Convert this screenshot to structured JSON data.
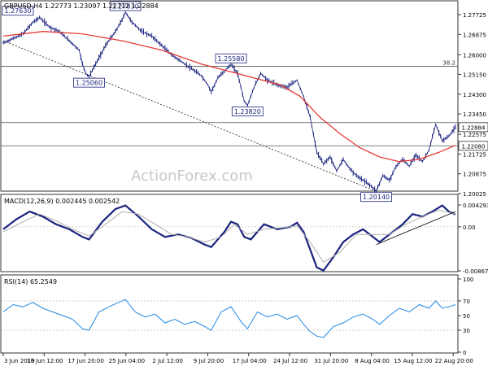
{
  "chart_data": [
    {
      "type": "candlestick",
      "header": "GBPUSD,H4  1.22773 1.23097 1.22712 1.22884",
      "watermark": "ActionForex.com",
      "ylim": [
        1.20025,
        1.27725
      ],
      "y_ticks": [
        "1.27725",
        "1.26875",
        "1.26000",
        "1.25150",
        "1.24300",
        "1.23450",
        "1.22575",
        "1.21725",
        "1.20875",
        "1.20025"
      ],
      "x_ticks": [
        "3 Jun 2019",
        "10 Jun 12:00",
        "17 Jun 20:00",
        "25 Jun 04:00",
        "2 Jul 12:00",
        "9 Jul 20:00",
        "17 Jul 04:00",
        "24 Jul 12:00",
        "31 Jul 20:00",
        "8 Aug 04:00",
        "15 Aug 12:00",
        "22 Aug 20:00"
      ],
      "price_path": [
        [
          0,
          1.265
        ],
        [
          3,
          1.267
        ],
        [
          6,
          1.269
        ],
        [
          9,
          1.274
        ],
        [
          11,
          1.276
        ],
        [
          14,
          1.272
        ],
        [
          17,
          1.27
        ],
        [
          20,
          1.266
        ],
        [
          23,
          1.262
        ],
        [
          24,
          1.256
        ],
        [
          25,
          1.252
        ],
        [
          26,
          1.2506
        ],
        [
          28,
          1.256
        ],
        [
          31,
          1.264
        ],
        [
          34,
          1.27
        ],
        [
          36,
          1.275
        ],
        [
          37,
          1.2783
        ],
        [
          39,
          1.274
        ],
        [
          42,
          1.27
        ],
        [
          45,
          1.268
        ],
        [
          48,
          1.264
        ],
        [
          51,
          1.26
        ],
        [
          54,
          1.257
        ],
        [
          57,
          1.254
        ],
        [
          60,
          1.251
        ],
        [
          62,
          1.247
        ],
        [
          63,
          1.244
        ],
        [
          65,
          1.25
        ],
        [
          67,
          1.253
        ],
        [
          69,
          1.2558
        ],
        [
          71,
          1.252
        ],
        [
          72,
          1.246
        ],
        [
          73,
          1.24
        ],
        [
          74,
          1.2382
        ],
        [
          76,
          1.246
        ],
        [
          78,
          1.252
        ],
        [
          80,
          1.249
        ],
        [
          83,
          1.247
        ],
        [
          86,
          1.246
        ],
        [
          89,
          1.249
        ],
        [
          91,
          1.242
        ],
        [
          93,
          1.233
        ],
        [
          95,
          1.218
        ],
        [
          97,
          1.213
        ],
        [
          99,
          1.216
        ],
        [
          101,
          1.21
        ],
        [
          103,
          1.215
        ],
        [
          105,
          1.211
        ],
        [
          107,
          1.208
        ],
        [
          109,
          1.206
        ],
        [
          111,
          1.204
        ],
        [
          113,
          1.2014
        ],
        [
          115,
          1.208
        ],
        [
          117,
          1.206
        ],
        [
          119,
          1.212
        ],
        [
          121,
          1.215
        ],
        [
          123,
          1.212
        ],
        [
          125,
          1.217
        ],
        [
          127,
          1.214
        ],
        [
          129,
          1.219
        ],
        [
          131,
          1.23
        ],
        [
          133,
          1.223
        ],
        [
          135,
          1.225
        ],
        [
          137,
          1.2288
        ]
      ],
      "moving_average": [
        [
          0,
          1.268
        ],
        [
          12,
          1.27
        ],
        [
          24,
          1.269
        ],
        [
          36,
          1.266
        ],
        [
          48,
          1.262
        ],
        [
          60,
          1.256
        ],
        [
          68,
          1.253
        ],
        [
          76,
          1.25
        ],
        [
          84,
          1.247
        ],
        [
          90,
          1.242
        ],
        [
          96,
          1.233
        ],
        [
          102,
          1.226
        ],
        [
          108,
          1.22
        ],
        [
          114,
          1.216
        ],
        [
          120,
          1.214
        ],
        [
          126,
          1.215
        ],
        [
          132,
          1.218
        ],
        [
          137,
          1.221
        ]
      ],
      "horizontal_levels": [
        {
          "value": 1.255,
          "label": "38.2"
        },
        {
          "value": 1.2308
        },
        {
          "value": 1.2208
        }
      ],
      "price_labels": [
        {
          "text": "1.27630",
          "x": 3,
          "y": 1.2763,
          "pos": "above"
        },
        {
          "text": "1.27830",
          "x": 37,
          "y": 1.2783,
          "pos": "above"
        },
        {
          "text": "1.25060",
          "x": 26,
          "y": 1.2506,
          "pos": "below"
        },
        {
          "text": "1.25580",
          "x": 69,
          "y": 1.2558,
          "pos": "above"
        },
        {
          "text": "1.23820",
          "x": 74,
          "y": 1.2382,
          "pos": "below"
        },
        {
          "text": "1.20140",
          "x": 113,
          "y": 1.2014,
          "pos": "below"
        }
      ],
      "axis_badges": [
        {
          "text": "1.22884",
          "value": 1.22884
        },
        {
          "text": "1.22080",
          "value": 1.2208
        }
      ],
      "trendline": [
        [
          0,
          1.266
        ],
        [
          113,
          1.2012
        ]
      ]
    },
    {
      "type": "line",
      "header": "MACD(12,26,9) 0.002445 0.002542",
      "ylim": [
        -0.00867,
        0.004293
      ],
      "y_ticks": [
        "0.004293",
        "0.00",
        "-0.00867"
      ],
      "series": [
        {
          "role": "macd",
          "points": [
            [
              0,
              -0.0005
            ],
            [
              4,
              0.0015
            ],
            [
              8,
              0.003
            ],
            [
              12,
              0.002
            ],
            [
              16,
              0.0005
            ],
            [
              20,
              -0.0005
            ],
            [
              24,
              -0.002
            ],
            [
              26,
              -0.0025
            ],
            [
              30,
              0.001
            ],
            [
              34,
              0.0035
            ],
            [
              37,
              0.0042
            ],
            [
              41,
              0.002
            ],
            [
              45,
              -0.0005
            ],
            [
              49,
              -0.002
            ],
            [
              53,
              -0.0015
            ],
            [
              57,
              -0.0022
            ],
            [
              61,
              -0.0035
            ],
            [
              63,
              -0.004
            ],
            [
              67,
              -0.001
            ],
            [
              69,
              0.001
            ],
            [
              71,
              0.0005
            ],
            [
              73,
              -0.002
            ],
            [
              75,
              -0.0025
            ],
            [
              79,
              0.0005
            ],
            [
              83,
              -0.0005
            ],
            [
              87,
              0.0
            ],
            [
              89,
              0.0008
            ],
            [
              91,
              -0.001
            ],
            [
              93,
              -0.0045
            ],
            [
              95,
              -0.008
            ],
            [
              97,
              -0.0086
            ],
            [
              100,
              -0.006
            ],
            [
              103,
              -0.003
            ],
            [
              106,
              -0.0015
            ],
            [
              109,
              -0.0005
            ],
            [
              112,
              -0.002
            ],
            [
              114,
              -0.003
            ],
            [
              118,
              -0.001
            ],
            [
              121,
              0.0005
            ],
            [
              124,
              0.0025
            ],
            [
              127,
              0.002
            ],
            [
              130,
              0.003
            ],
            [
              133,
              0.0042
            ],
            [
              135,
              0.003
            ],
            [
              137,
              0.0024
            ]
          ]
        },
        {
          "role": "signal",
          "points": [
            [
              0,
              -0.001
            ],
            [
              6,
              0.001
            ],
            [
              11,
              0.0025
            ],
            [
              16,
              0.0012
            ],
            [
              21,
              -0.0005
            ],
            [
              26,
              -0.0018
            ],
            [
              31,
              0.0005
            ],
            [
              36,
              0.003
            ],
            [
              41,
              0.0025
            ],
            [
              46,
              0.0005
            ],
            [
              51,
              -0.0015
            ],
            [
              56,
              -0.002
            ],
            [
              61,
              -0.003
            ],
            [
              66,
              -0.002
            ],
            [
              70,
              0.0005
            ],
            [
              74,
              -0.0015
            ],
            [
              79,
              -0.0005
            ],
            [
              84,
              -0.0002
            ],
            [
              89,
              0.0002
            ],
            [
              93,
              -0.003
            ],
            [
              97,
              -0.007
            ],
            [
              102,
              -0.005
            ],
            [
              107,
              -0.0015
            ],
            [
              112,
              -0.0015
            ],
            [
              117,
              -0.0015
            ],
            [
              122,
              0.0005
            ],
            [
              127,
              0.002
            ],
            [
              132,
              0.0033
            ],
            [
              137,
              0.0025
            ]
          ]
        }
      ],
      "trendline": [
        [
          113,
          -0.0035
        ],
        [
          137,
          0.003
        ]
      ]
    },
    {
      "type": "line",
      "header": "RSI(14) 65.2549",
      "ylim": [
        0,
        100
      ],
      "y_ticks": [
        "100",
        "70",
        "50",
        "30",
        "0"
      ],
      "levels": [
        70,
        30
      ],
      "series": [
        {
          "role": "rsi",
          "points": [
            [
              0,
              55
            ],
            [
              3,
              65
            ],
            [
              6,
              62
            ],
            [
              9,
              68
            ],
            [
              12,
              60
            ],
            [
              15,
              55
            ],
            [
              18,
              50
            ],
            [
              21,
              45
            ],
            [
              24,
              32
            ],
            [
              26,
              30
            ],
            [
              29,
              55
            ],
            [
              32,
              62
            ],
            [
              35,
              68
            ],
            [
              37,
              72
            ],
            [
              40,
              55
            ],
            [
              43,
              48
            ],
            [
              46,
              52
            ],
            [
              49,
              40
            ],
            [
              52,
              45
            ],
            [
              55,
              38
            ],
            [
              58,
              42
            ],
            [
              61,
              35
            ],
            [
              63,
              30
            ],
            [
              66,
              55
            ],
            [
              69,
              62
            ],
            [
              72,
              42
            ],
            [
              74,
              32
            ],
            [
              77,
              55
            ],
            [
              80,
              48
            ],
            [
              83,
              52
            ],
            [
              86,
              45
            ],
            [
              89,
              50
            ],
            [
              91,
              38
            ],
            [
              93,
              28
            ],
            [
              95,
              22
            ],
            [
              97,
              20
            ],
            [
              100,
              35
            ],
            [
              103,
              40
            ],
            [
              106,
              48
            ],
            [
              109,
              52
            ],
            [
              112,
              45
            ],
            [
              114,
              38
            ],
            [
              117,
              50
            ],
            [
              120,
              60
            ],
            [
              123,
              55
            ],
            [
              126,
              65
            ],
            [
              129,
              60
            ],
            [
              131,
              70
            ],
            [
              133,
              60
            ],
            [
              135,
              62
            ],
            [
              137,
              65
            ]
          ]
        }
      ]
    }
  ]
}
